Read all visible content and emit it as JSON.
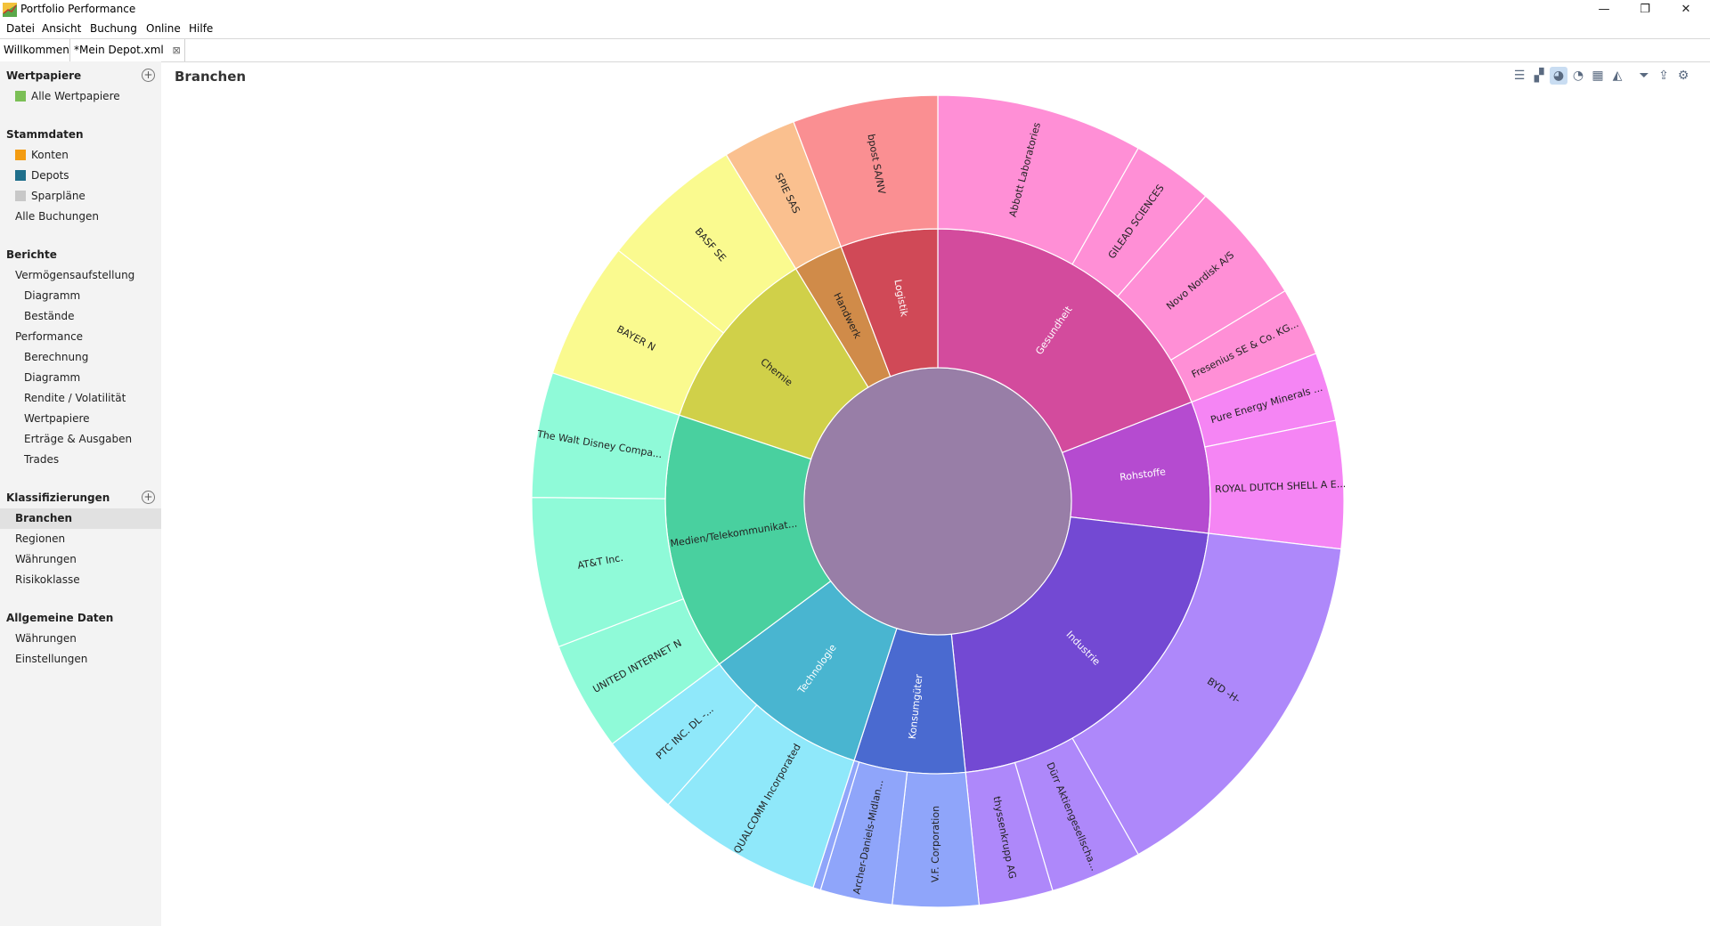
{
  "window": {
    "title": "Portfolio Performance",
    "minimize": "—",
    "maximize": "❐",
    "close": "✕"
  },
  "menu": [
    "Datei",
    "Ansicht",
    "Buchung",
    "Online",
    "Hilfe"
  ],
  "tabs": [
    {
      "label": "Willkommen"
    },
    {
      "label": "*Mein Depot.xml",
      "close": "⊠"
    }
  ],
  "sidebar": {
    "wertpapiere": {
      "title": "Wertpapiere",
      "items": [
        "Alle Wertpapiere"
      ]
    },
    "stammdaten": {
      "title": "Stammdaten",
      "items": [
        "Konten",
        "Depots",
        "Sparpläne",
        "Alle Buchungen"
      ]
    },
    "berichte": {
      "title": "Berichte",
      "items": [
        "Vermögensaufstellung",
        "Diagramm",
        "Bestände",
        "Performance",
        "Berechnung",
        "Diagramm",
        "Rendite / Volatilität",
        "Wertpapiere",
        "Erträge & Ausgaben",
        "Trades"
      ]
    },
    "klassifizierungen": {
      "title": "Klassifizierungen",
      "items": [
        "Branchen",
        "Regionen",
        "Währungen",
        "Risikoklasse"
      ]
    },
    "allgemein": {
      "title": "Allgemeine Daten",
      "items": [
        "Währungen",
        "Einstellungen"
      ]
    }
  },
  "page": {
    "title": "Branchen"
  },
  "toolbar": {
    "icons": [
      "list-view-icon",
      "treemap-icon",
      "donut-chart-icon",
      "pie-chart-icon",
      "grid-icon",
      "area-chart-icon",
      "filter-icon",
      "export-icon",
      "settings-icon"
    ],
    "active": "donut-chart-icon"
  },
  "chart_data": {
    "type": "sunburst",
    "center_color": "#987ea7",
    "categories": [
      {
        "name": "Gesundheit",
        "value": 18.8,
        "color": "#d34b9d",
        "children": [
          {
            "name": "Abbott Laboratories",
            "value": 8.1,
            "color": "#ff8fd6"
          },
          {
            "name": "GILEAD SCIENCES",
            "value": 3.2,
            "color": "#ff8fd6"
          },
          {
            "name": "Novo Nordisk A/S",
            "value": 4.8,
            "color": "#ff8fd6"
          },
          {
            "name": "Fresenius SE & Co. KG...",
            "value": 2.7,
            "color": "#ff8fd6"
          }
        ]
      },
      {
        "name": "Rohstoffe",
        "value": 7.7,
        "color": "#b54bd0",
        "children": [
          {
            "name": "Pure Energy Minerals ...",
            "value": 2.7,
            "color": "#f585f4"
          },
          {
            "name": "ROYAL DUTCH SHELL A E...",
            "value": 5.0,
            "color": "#f585f4"
          }
        ]
      },
      {
        "name": "Industrie",
        "value": 21.2,
        "color": "#7349d3",
        "children": [
          {
            "name": "BYD -H-",
            "value": 14.7,
            "color": "#ae88fa"
          },
          {
            "name": "Dürr Aktiengesellscha...",
            "value": 3.6,
            "color": "#ae88fa"
          },
          {
            "name": "thyssenkrupp AG",
            "value": 2.9,
            "color": "#ae88fa"
          }
        ]
      },
      {
        "name": "Konsumgüter",
        "value": 6.5,
        "color": "#4a6ad0",
        "children": [
          {
            "name": "V.F. Corporation",
            "value": 5.6,
            "color": "#8fa5fa"
          },
          {
            "name": "Archer-Daniels-Midlan...",
            "value": 4.7,
            "color": "#8fa5fa"
          },
          {
            "name": "",
            "value": 0.5,
            "color": "#8fa5fa"
          }
        ]
      },
      {
        "name": "Technologie",
        "value": 9.7,
        "color": "#49b5d0",
        "children": [
          {
            "name": "QUALCOMM Incorporated",
            "value": 6.5,
            "color": "#8fe8fa"
          },
          {
            "name": "PTC INC. DL -...",
            "value": 3.2,
            "color": "#8fe8fa"
          }
        ]
      },
      {
        "name": "Medien/Telekommunikat...",
        "value": 15.1,
        "color": "#49d09f",
        "children": [
          {
            "name": "UNITED INTERNET N",
            "value": 4.3,
            "color": "#8ffad8"
          },
          {
            "name": "AT&T Inc.",
            "value": 5.9,
            "color": "#8ffad8"
          },
          {
            "name": "The Walt Disney Compa...",
            "value": 4.9,
            "color": "#8ffad8"
          }
        ]
      },
      {
        "name": "Chemie",
        "value": 11.0,
        "color": "#d0d049",
        "children": [
          {
            "name": "BAYER N",
            "value": 5.4,
            "color": "#fafa8f"
          },
          {
            "name": "BASF SE",
            "value": 5.6,
            "color": "#fafa8f"
          }
        ]
      },
      {
        "name": "Handwerk",
        "value": 2.9,
        "color": "#d08b49",
        "children": [
          {
            "name": "SPIE SAS",
            "value": 2.9,
            "color": "#fac08f"
          }
        ]
      },
      {
        "name": "Logistik",
        "value": 5.7,
        "color": "#d04957",
        "children": [
          {
            "name": "bpost SA/NV",
            "value": 5.7,
            "color": "#fa8f92"
          }
        ]
      }
    ]
  }
}
